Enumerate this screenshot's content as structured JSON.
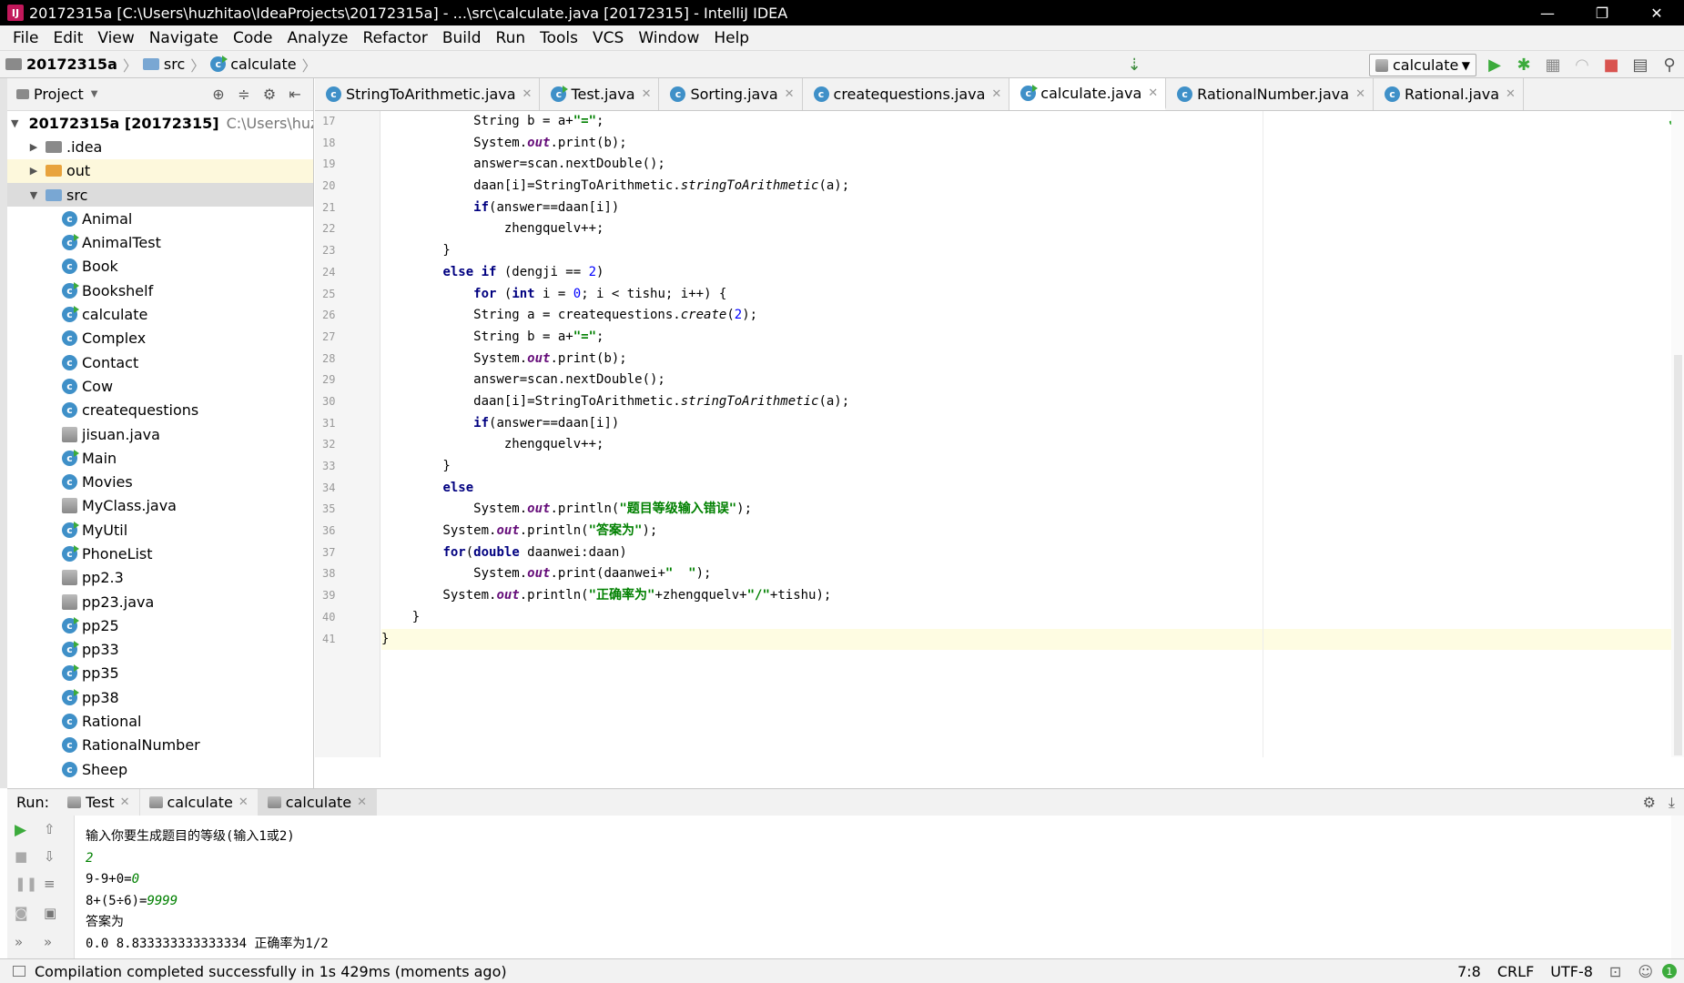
{
  "window": {
    "title": "20172315a [C:\\Users\\huzhitao\\IdeaProjects\\20172315a] - ...\\src\\calculate.java [20172315] - IntelliJ IDEA"
  },
  "menu": [
    "File",
    "Edit",
    "View",
    "Navigate",
    "Code",
    "Analyze",
    "Refactor",
    "Build",
    "Run",
    "Tools",
    "VCS",
    "Window",
    "Help"
  ],
  "breadcrumb": {
    "project": "20172315a",
    "folder": "src",
    "file": "calculate"
  },
  "run_config": "calculate",
  "project_panel": {
    "title": "Project",
    "root_name": "20172315a [20172315]",
    "root_path": "C:\\Users\\huzhitao",
    "folders": [
      ".idea",
      "out",
      "src"
    ],
    "files": [
      "Animal",
      "AnimalTest",
      "Book",
      "Bookshelf",
      "calculate",
      "Complex",
      "Contact",
      "Cow",
      "createquestions",
      "jisuan.java",
      "Main",
      "Movies",
      "MyClass.java",
      "MyUtil",
      "PhoneList",
      "pp2.3",
      "pp23.java",
      "pp25",
      "pp33",
      "pp35",
      "pp38",
      "Rational",
      "RationalNumber",
      "Sheep"
    ]
  },
  "editor_tabs": [
    "StringToArithmetic.java",
    "Test.java",
    "Sorting.java",
    "createquestions.java",
    "calculate.java",
    "RationalNumber.java",
    "Rational.java"
  ],
  "line_numbers": [
    "17",
    "18",
    "19",
    "20",
    "21",
    "22",
    "23",
    "24",
    "25",
    "26",
    "27",
    "28",
    "29",
    "30",
    "31",
    "32",
    "33",
    "34",
    "35",
    "36",
    "37",
    "38",
    "39",
    "40",
    "41"
  ],
  "run_panel": {
    "label": "Run:",
    "tabs": [
      "Test",
      "calculate",
      "calculate"
    ]
  },
  "console": {
    "prompt": "输入你要生成题目的等级(输入1或2)",
    "input1": "2",
    "q1": "9-9+0=",
    "a1": "0",
    "q2": "8+(5÷6)=",
    "a2": "9999",
    "answer_label": "答案为",
    "result": "0.0 8.833333333333334 正确率为1/2"
  },
  "status": {
    "message": "Compilation completed successfully in 1s 429ms (moments ago)",
    "position": "7:8",
    "line_sep": "CRLF",
    "encoding": "UTF-8"
  },
  "colors": {
    "keyword": "#000080",
    "string": "#008000",
    "number": "#0000ff",
    "class_icon": "#3f90c8"
  }
}
